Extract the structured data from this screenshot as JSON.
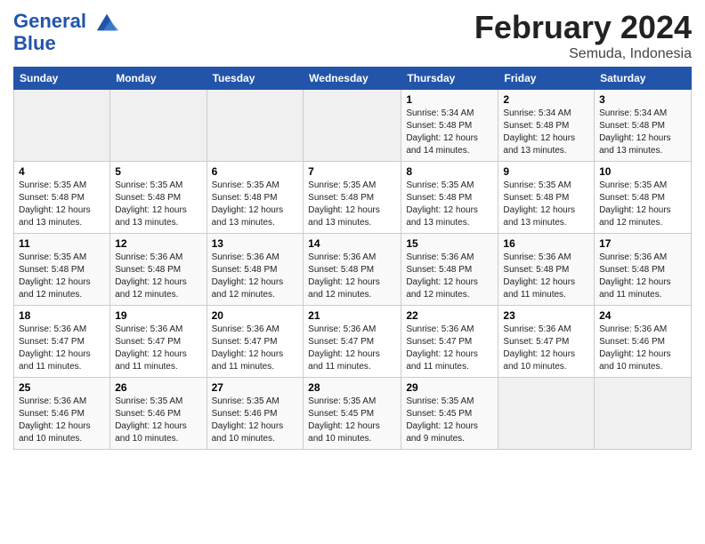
{
  "header": {
    "logo_line1": "General",
    "logo_line2": "Blue",
    "month_title": "February 2024",
    "subtitle": "Semuda, Indonesia"
  },
  "weekdays": [
    "Sunday",
    "Monday",
    "Tuesday",
    "Wednesday",
    "Thursday",
    "Friday",
    "Saturday"
  ],
  "weeks": [
    [
      {
        "day": "",
        "info": ""
      },
      {
        "day": "",
        "info": ""
      },
      {
        "day": "",
        "info": ""
      },
      {
        "day": "",
        "info": ""
      },
      {
        "day": "1",
        "info": "Sunrise: 5:34 AM\nSunset: 5:48 PM\nDaylight: 12 hours\nand 14 minutes."
      },
      {
        "day": "2",
        "info": "Sunrise: 5:34 AM\nSunset: 5:48 PM\nDaylight: 12 hours\nand 13 minutes."
      },
      {
        "day": "3",
        "info": "Sunrise: 5:34 AM\nSunset: 5:48 PM\nDaylight: 12 hours\nand 13 minutes."
      }
    ],
    [
      {
        "day": "4",
        "info": "Sunrise: 5:35 AM\nSunset: 5:48 PM\nDaylight: 12 hours\nand 13 minutes."
      },
      {
        "day": "5",
        "info": "Sunrise: 5:35 AM\nSunset: 5:48 PM\nDaylight: 12 hours\nand 13 minutes."
      },
      {
        "day": "6",
        "info": "Sunrise: 5:35 AM\nSunset: 5:48 PM\nDaylight: 12 hours\nand 13 minutes."
      },
      {
        "day": "7",
        "info": "Sunrise: 5:35 AM\nSunset: 5:48 PM\nDaylight: 12 hours\nand 13 minutes."
      },
      {
        "day": "8",
        "info": "Sunrise: 5:35 AM\nSunset: 5:48 PM\nDaylight: 12 hours\nand 13 minutes."
      },
      {
        "day": "9",
        "info": "Sunrise: 5:35 AM\nSunset: 5:48 PM\nDaylight: 12 hours\nand 13 minutes."
      },
      {
        "day": "10",
        "info": "Sunrise: 5:35 AM\nSunset: 5:48 PM\nDaylight: 12 hours\nand 12 minutes."
      }
    ],
    [
      {
        "day": "11",
        "info": "Sunrise: 5:35 AM\nSunset: 5:48 PM\nDaylight: 12 hours\nand 12 minutes."
      },
      {
        "day": "12",
        "info": "Sunrise: 5:36 AM\nSunset: 5:48 PM\nDaylight: 12 hours\nand 12 minutes."
      },
      {
        "day": "13",
        "info": "Sunrise: 5:36 AM\nSunset: 5:48 PM\nDaylight: 12 hours\nand 12 minutes."
      },
      {
        "day": "14",
        "info": "Sunrise: 5:36 AM\nSunset: 5:48 PM\nDaylight: 12 hours\nand 12 minutes."
      },
      {
        "day": "15",
        "info": "Sunrise: 5:36 AM\nSunset: 5:48 PM\nDaylight: 12 hours\nand 12 minutes."
      },
      {
        "day": "16",
        "info": "Sunrise: 5:36 AM\nSunset: 5:48 PM\nDaylight: 12 hours\nand 11 minutes."
      },
      {
        "day": "17",
        "info": "Sunrise: 5:36 AM\nSunset: 5:48 PM\nDaylight: 12 hours\nand 11 minutes."
      }
    ],
    [
      {
        "day": "18",
        "info": "Sunrise: 5:36 AM\nSunset: 5:47 PM\nDaylight: 12 hours\nand 11 minutes."
      },
      {
        "day": "19",
        "info": "Sunrise: 5:36 AM\nSunset: 5:47 PM\nDaylight: 12 hours\nand 11 minutes."
      },
      {
        "day": "20",
        "info": "Sunrise: 5:36 AM\nSunset: 5:47 PM\nDaylight: 12 hours\nand 11 minutes."
      },
      {
        "day": "21",
        "info": "Sunrise: 5:36 AM\nSunset: 5:47 PM\nDaylight: 12 hours\nand 11 minutes."
      },
      {
        "day": "22",
        "info": "Sunrise: 5:36 AM\nSunset: 5:47 PM\nDaylight: 12 hours\nand 11 minutes."
      },
      {
        "day": "23",
        "info": "Sunrise: 5:36 AM\nSunset: 5:47 PM\nDaylight: 12 hours\nand 10 minutes."
      },
      {
        "day": "24",
        "info": "Sunrise: 5:36 AM\nSunset: 5:46 PM\nDaylight: 12 hours\nand 10 minutes."
      }
    ],
    [
      {
        "day": "25",
        "info": "Sunrise: 5:36 AM\nSunset: 5:46 PM\nDaylight: 12 hours\nand 10 minutes."
      },
      {
        "day": "26",
        "info": "Sunrise: 5:35 AM\nSunset: 5:46 PM\nDaylight: 12 hours\nand 10 minutes."
      },
      {
        "day": "27",
        "info": "Sunrise: 5:35 AM\nSunset: 5:46 PM\nDaylight: 12 hours\nand 10 minutes."
      },
      {
        "day": "28",
        "info": "Sunrise: 5:35 AM\nSunset: 5:45 PM\nDaylight: 12 hours\nand 10 minutes."
      },
      {
        "day": "29",
        "info": "Sunrise: 5:35 AM\nSunset: 5:45 PM\nDaylight: 12 hours\nand 9 minutes."
      },
      {
        "day": "",
        "info": ""
      },
      {
        "day": "",
        "info": ""
      }
    ]
  ]
}
